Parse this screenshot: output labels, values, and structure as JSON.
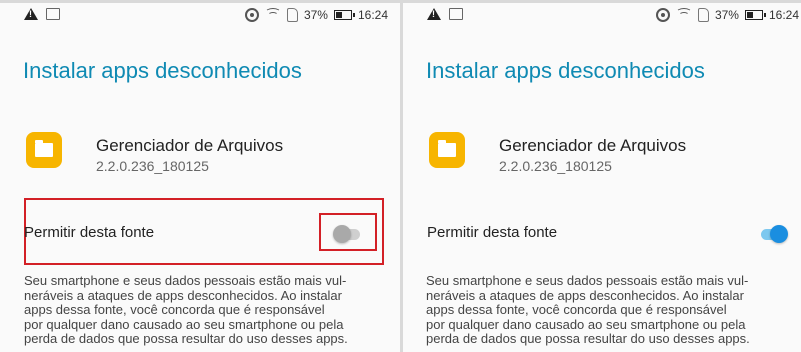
{
  "panels": [
    {
      "status": {
        "battery": "37%",
        "time": "16:24"
      },
      "title": "Instalar apps desconhecidos",
      "app": {
        "name": "Gerenciador de Arquivos",
        "version": "2.2.0.236_180125"
      },
      "permission": {
        "label": "Permitir desta fonte",
        "enabled": false
      },
      "description": "Seu smartphone e seus dados pessoais estão mais vul-\nneráveis a ataques de apps desconhecidos. Ao instalar\napps dessa fonte, você concorda que é responsável\npor qualquer dano causado ao seu smartphone ou pela\nperda de dados que possa resultar do uso desses apps."
    },
    {
      "status": {
        "battery": "37%",
        "time": "16:24"
      },
      "title": "Instalar apps desconhecidos",
      "app": {
        "name": "Gerenciador de Arquivos",
        "version": "2.2.0.236_180125"
      },
      "permission": {
        "label": "Permitir desta fonte",
        "enabled": true
      },
      "description": "Seu smartphone e seus dados pessoais estão mais vul-\nneráveis a ataques de apps desconhecidos. Ao instalar\napps dessa fonte, você concorda que é responsável\npor qualquer dano causado ao seu smartphone ou pela\nperda de dados que possa resultar do uso desses apps."
    }
  ],
  "colors": {
    "title": "#0f8ab3",
    "highlight": "#d32026",
    "app_icon": "#f7b500",
    "toggle_on": "#1a8ee0",
    "toggle_off": "#a9a9a9"
  },
  "icons": [
    "alert-icon",
    "image-icon",
    "sync-icon",
    "wifi-icon",
    "nosim-icon",
    "battery-icon",
    "folder-icon"
  ]
}
